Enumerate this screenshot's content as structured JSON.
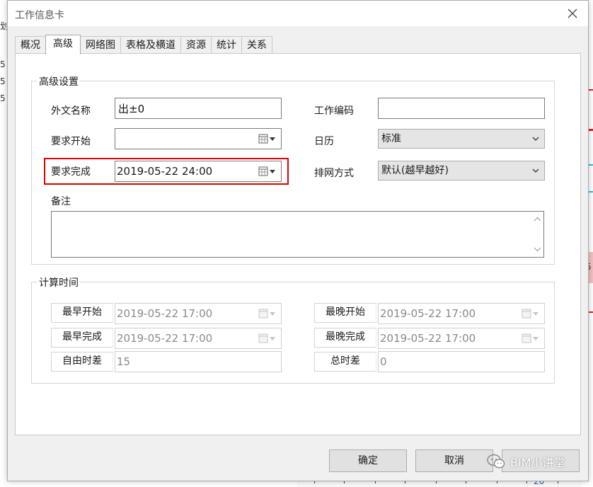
{
  "dialog": {
    "title": "工作信息卡"
  },
  "tabs": [
    {
      "label": "概况"
    },
    {
      "label": "高级"
    },
    {
      "label": "网络图"
    },
    {
      "label": "表格及横道"
    },
    {
      "label": "资源"
    },
    {
      "label": "统计"
    },
    {
      "label": "关系"
    }
  ],
  "advanced": {
    "group_title": "高级设置",
    "foreign_name": {
      "label": "外文名称",
      "value": "出±0"
    },
    "work_code": {
      "label": "工作编码",
      "value": ""
    },
    "req_start": {
      "label": "要求开始",
      "value": ""
    },
    "calendar": {
      "label": "日历",
      "value": "标准"
    },
    "req_finish": {
      "label": "要求完成",
      "value": "2019-05-22 24:00"
    },
    "scheduling": {
      "label": "排网方式",
      "value": "默认(越早越好)"
    },
    "notes": {
      "label": "备注",
      "value": ""
    }
  },
  "computed": {
    "group_title": "计算时间",
    "early_start": {
      "label": "最早开始",
      "value": "2019-05-22 17:00"
    },
    "late_start": {
      "label": "最晚开始",
      "value": "2019-05-22 17:00"
    },
    "early_finish": {
      "label": "最早完成",
      "value": "2019-05-22 17:00"
    },
    "late_finish": {
      "label": "最晚完成",
      "value": "2019-05-22 17:00"
    },
    "free_float": {
      "label": "自由时差",
      "value": "15"
    },
    "total_float": {
      "label": "总时差",
      "value": "0"
    }
  },
  "buttons": {
    "ok": "确定",
    "cancel": "取消"
  },
  "watermark": {
    "text": "BIM小讲堂"
  },
  "background": {
    "frag_top": "划",
    "frag_rows": [
      "5",
      "5",
      "5"
    ],
    "frag_right": "5",
    "frag_bottom": "20"
  },
  "colors": {
    "highlight": "#e00000",
    "accent_red": "#e02020",
    "accent_cyan": "#20c0e0"
  }
}
